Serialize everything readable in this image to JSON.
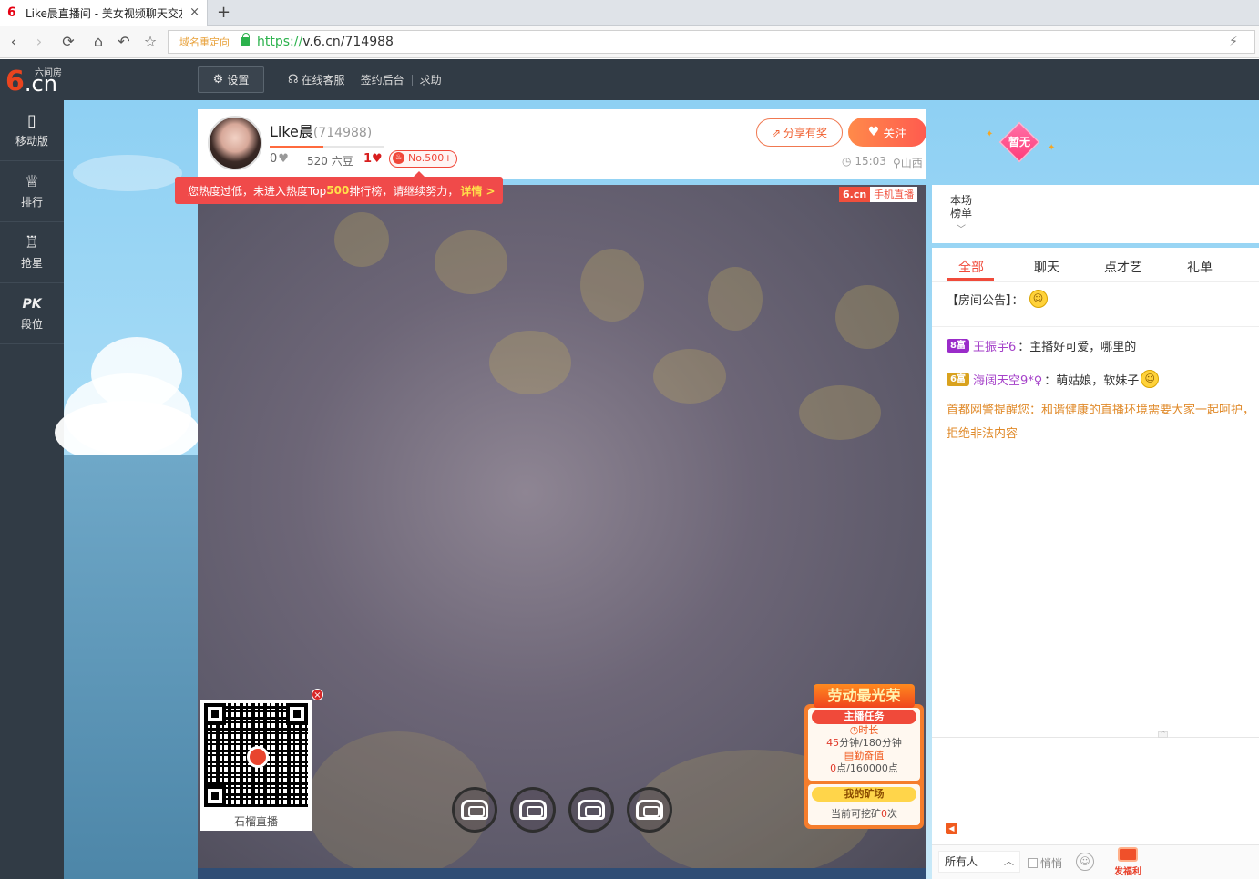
{
  "browser": {
    "tab_title": "Like晨直播间 - 美女视频聊天交友",
    "tab_close": "×",
    "new_tab": "+",
    "redirect_tag": "域名重定向",
    "url_scheme": "https://",
    "url_rest": "v.6.cn/714988"
  },
  "site": {
    "logo_six": "6",
    "logo_cn": ".cn",
    "logo_sub": "六间房",
    "settings_label": "设置",
    "header_links": [
      "在线客服",
      "签约后台",
      "求助"
    ]
  },
  "sidebar": {
    "items": [
      {
        "label": "移动版",
        "icon": "mobile-icon"
      },
      {
        "label": "排行",
        "icon": "crown-icon"
      },
      {
        "label": "抢星",
        "icon": "star-grab-icon"
      },
      {
        "label": "段位",
        "icon": "pk-icon",
        "icon_text": "PK"
      }
    ]
  },
  "anchor": {
    "name": "Like晨",
    "id": "(714988)",
    "fame_progress": 0.47,
    "hearts": "0",
    "beans": "520 六豆",
    "level": "1",
    "rank": "No.500+",
    "share_label": "分享有奖",
    "follow_label": "关注",
    "time": "15:03",
    "location": "山西",
    "badge_text": "暂无"
  },
  "heat_tip": {
    "prefix": "您热度过低，未进入热度Top",
    "highlight": "500",
    "suffix": "排行榜，请继续努力，",
    "detail": "详情 >"
  },
  "video": {
    "mobile_tag_a": "6.cn",
    "mobile_tag_b": "手机直播",
    "qr_label": "石榴直播",
    "qr_close": "×",
    "seats": 4
  },
  "task": {
    "banner": "劳动最光荣",
    "head": "主播任务",
    "duration_label": "时长",
    "duration_done": "45",
    "duration_value": "分钟/180分钟",
    "diligence_label": "勤奋值",
    "diligence_done": "0",
    "diligence_value": "点/160000点",
    "mine_head": "我的矿场",
    "mine_prefix": "当前可挖矿",
    "mine_count": "0",
    "mine_suffix": "次"
  },
  "rank_panel": {
    "label": "本场榜单"
  },
  "chat": {
    "tabs": [
      "全部",
      "聊天",
      "点才艺",
      "礼单"
    ],
    "announce": "【房间公告】：",
    "messages": [
      {
        "level": "8富",
        "user": "王振宇6",
        "text": "：主播好可爱，哪里的",
        "color": "#9a2bc9"
      },
      {
        "level": "6富",
        "user": "海阔天空9*♀",
        "text": "：萌姑娘，软妹子",
        "color": "#d9a21e"
      }
    ],
    "notice": "首都网警提醒您：和谐健康的直播环境需要大家一起呵护，拒绝非法内容",
    "recipient": "所有人",
    "whisper": "悄悄",
    "welfare": "发福利"
  }
}
